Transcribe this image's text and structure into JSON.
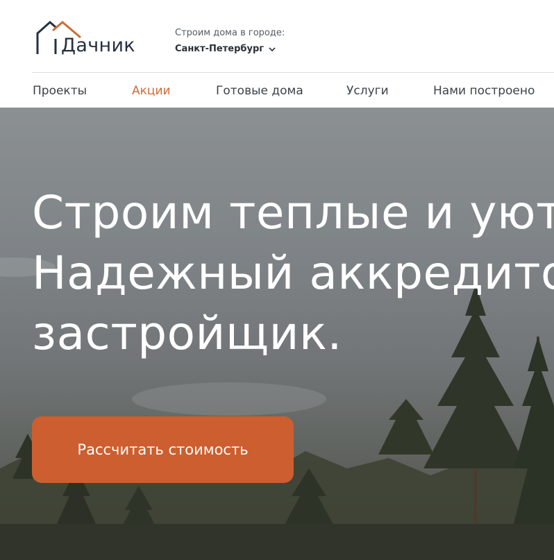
{
  "brand": {
    "name": "Дачник",
    "accent": "#cf6a3a",
    "dark": "#263040"
  },
  "city": {
    "caption": "Строим дома в городе:",
    "selected": "Санкт-Петербург",
    "icon": "chevron-down-icon"
  },
  "nav": {
    "items": [
      {
        "label": "Проекты",
        "active": false
      },
      {
        "label": "Акции",
        "active": true
      },
      {
        "label": "Готовые дома",
        "active": false
      },
      {
        "label": "Услуги",
        "active": false
      },
      {
        "label": "Нами построено",
        "active": false
      }
    ]
  },
  "hero": {
    "lines": [
      "Строим теплые  и уютн",
      "Надежный  аккредитов",
      "застройщик."
    ],
    "cta_label": "Рассчитать стоимость",
    "cta_color": "#cc5e2f"
  }
}
